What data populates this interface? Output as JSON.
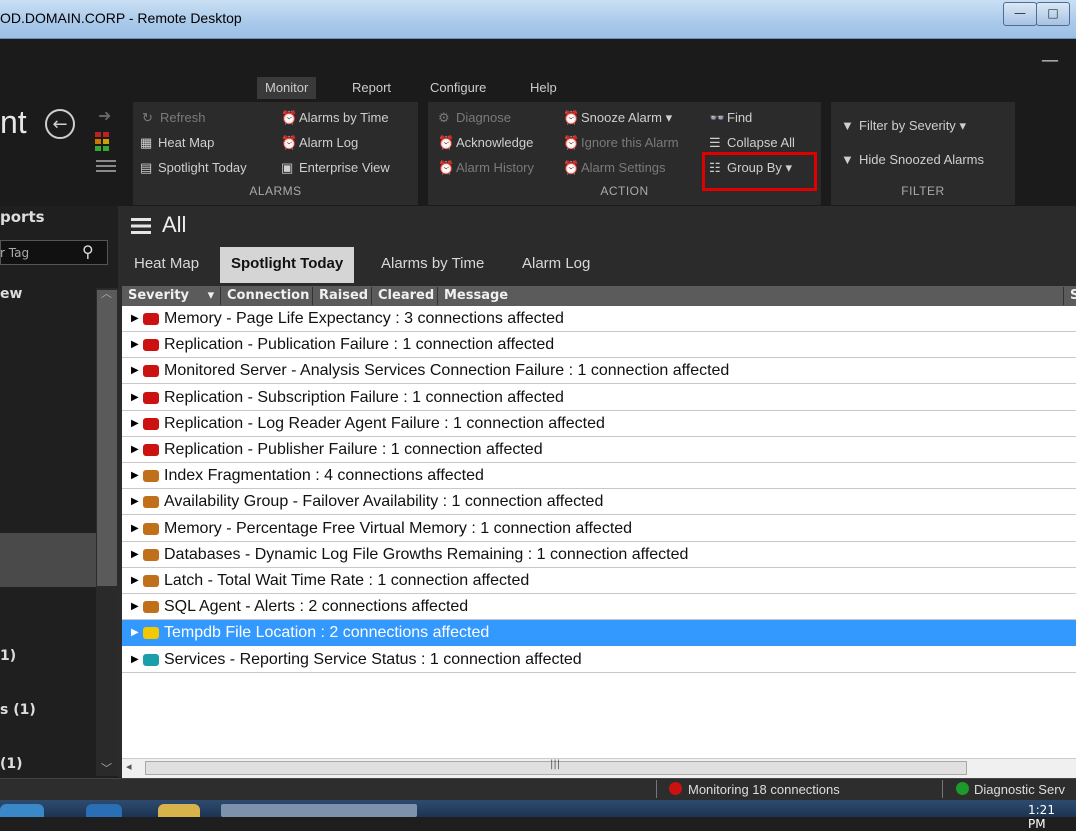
{
  "window": {
    "title": "OD.DOMAIN.CORP - Remote Desktop"
  },
  "app": {
    "title_fragment": "nt"
  },
  "menu": {
    "tabs": [
      {
        "label": "Monitor",
        "active": true
      },
      {
        "label": "Report"
      },
      {
        "label": "Configure"
      },
      {
        "label": "Help"
      }
    ]
  },
  "ribbon": {
    "alarms": {
      "label": "ALARMS",
      "refresh": "Refresh",
      "heat_map": "Heat Map",
      "spotlight_today": "Spotlight Today",
      "alarms_by_time": "Alarms by Time",
      "alarm_log": "Alarm Log",
      "enterprise_view": "Enterprise View"
    },
    "action": {
      "label": "ACTION",
      "diagnose": "Diagnose",
      "acknowledge": "Acknowledge",
      "alarm_history": "Alarm History",
      "snooze_alarm": "Snooze Alarm",
      "ignore_alarm": "Ignore this Alarm",
      "alarm_settings": "Alarm Settings",
      "find": "Find",
      "collapse_all": "Collapse All",
      "group_by": "Group By"
    },
    "filter": {
      "label": "FILTER",
      "filter_by_severity": "Filter by Severity",
      "hide_snoozed": "Hide Snoozed Alarms"
    }
  },
  "left_panel": {
    "header": "ports",
    "search_placeholder": "r Tag",
    "view_label": "ew",
    "items": [
      "1)",
      "s (1)",
      "(1)"
    ]
  },
  "main": {
    "title": "All",
    "tabs": [
      {
        "label": "Heat Map"
      },
      {
        "label": "Spotlight Today",
        "active": true
      },
      {
        "label": "Alarms by Time"
      },
      {
        "label": "Alarm Log"
      }
    ],
    "columns": [
      "Severity",
      "Connection",
      "Raised",
      "Cleared",
      "Message",
      "S"
    ],
    "rows": [
      {
        "text": "Memory - Page Life Expectancy : 3 connections affected",
        "severity": "critical"
      },
      {
        "text": "Replication - Publication Failure : 1 connection affected",
        "severity": "critical"
      },
      {
        "text": "Monitored Server - Analysis Services Connection Failure : 1 connection affected",
        "severity": "critical"
      },
      {
        "text": "Replication - Subscription Failure : 1 connection affected",
        "severity": "critical"
      },
      {
        "text": "Replication - Log Reader Agent Failure : 1 connection affected",
        "severity": "critical"
      },
      {
        "text": "Replication - Publisher Failure : 1 connection affected",
        "severity": "critical"
      },
      {
        "text": "Index Fragmentation : 4 connections affected",
        "severity": "warning"
      },
      {
        "text": "Availability Group - Failover Availability : 1 connection affected",
        "severity": "warning"
      },
      {
        "text": "Memory - Percentage Free Virtual Memory : 1 connection affected",
        "severity": "warning"
      },
      {
        "text": "Databases - Dynamic Log File Growths Remaining : 1 connection affected",
        "severity": "warning"
      },
      {
        "text": "Latch - Total Wait Time Rate : 1 connection affected",
        "severity": "warning"
      },
      {
        "text": "SQL Agent - Alerts : 2 connections affected",
        "severity": "warning"
      },
      {
        "text": "Tempdb File Location : 2 connections affected",
        "severity": "low",
        "selected": true
      },
      {
        "text": "Services - Reporting Service Status : 1 connection affected",
        "severity": "info"
      }
    ]
  },
  "status_bar": {
    "monitoring": "Monitoring 18 connections",
    "diagnostic": "Diagnostic Serv"
  },
  "taskbar": {
    "clock": "1:21 PM"
  },
  "colors": {
    "critical": "#cc1111",
    "warning": "#c0701a",
    "low": "#f3c800",
    "info": "#1a9fa8",
    "selection": "#3399ff",
    "highlight_box": "#e00000"
  }
}
